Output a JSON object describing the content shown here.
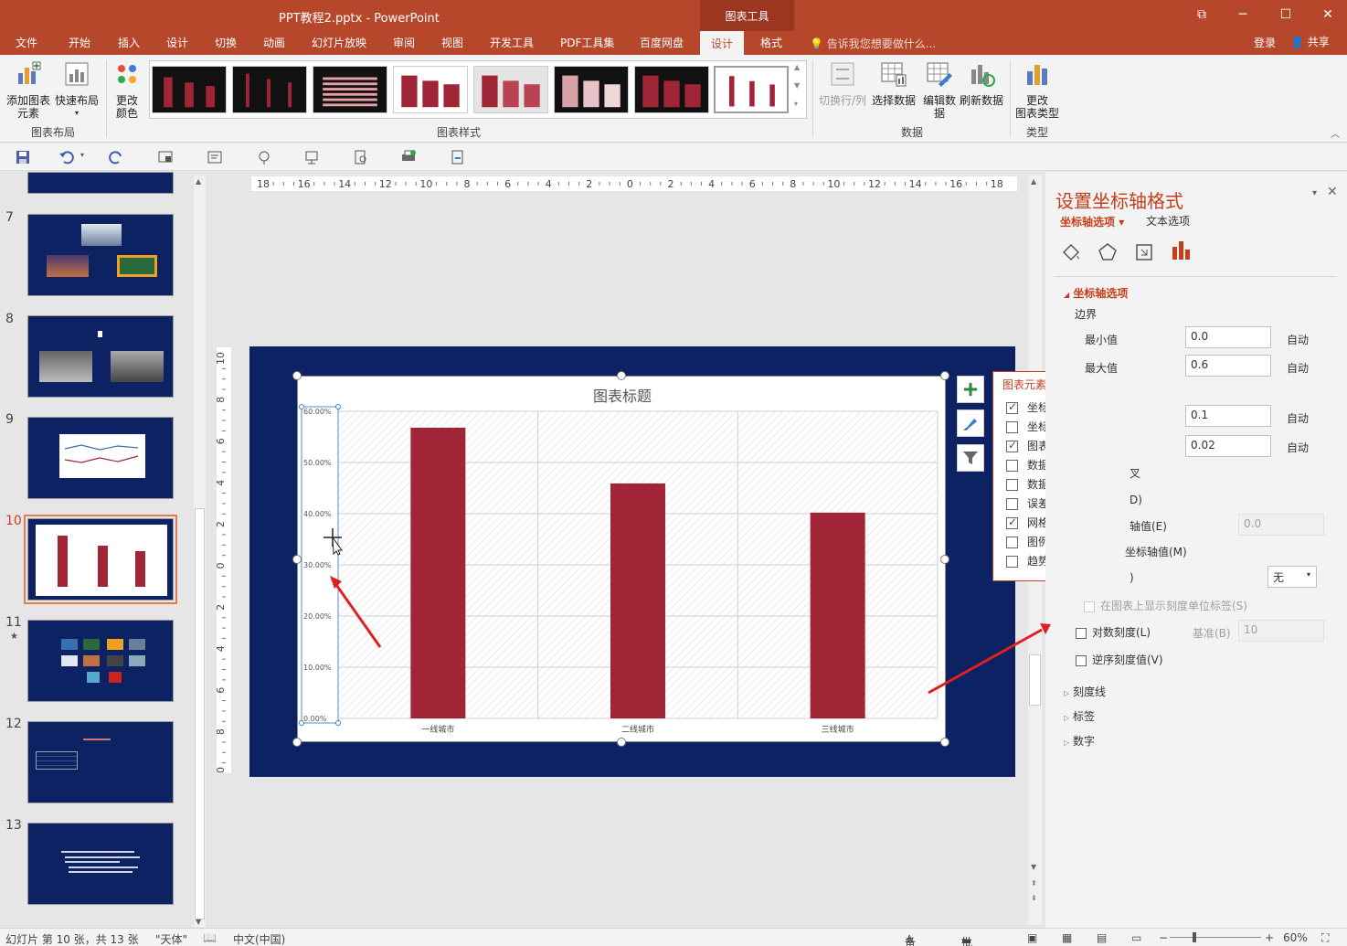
{
  "window": {
    "title": "PPT教程2.pptx - PowerPoint",
    "context_group": "图表工具",
    "restore_glyph": "⧉",
    "minimize_glyph": "─",
    "maximize_glyph": "☐",
    "close_glyph": "✕"
  },
  "tabs": [
    "文件",
    "开始",
    "插入",
    "设计",
    "切换",
    "动画",
    "幻灯片放映",
    "审阅",
    "视图",
    "开发工具",
    "PDF工具集",
    "百度网盘",
    "设计",
    "格式"
  ],
  "active_tab_index": 12,
  "tell_me": "告诉我您想要做什么...",
  "login": "登录",
  "share": "共享",
  "ribbon": {
    "add_element": "添加图表\n元素",
    "quick_layout": "快速布局",
    "group_layout": "图表布局",
    "change_colors": "更改\n颜色",
    "group_styles": "图表样式",
    "switch_row_col": "切换行/列",
    "select_data": "选择数据",
    "edit_data": "编辑数\n据",
    "refresh_data": "刷新数据",
    "group_data": "数据",
    "change_type": "更改\n图表类型",
    "group_type": "类型"
  },
  "slides": [
    {
      "num": "7"
    },
    {
      "num": "8"
    },
    {
      "num": "9"
    },
    {
      "num": "10"
    },
    {
      "num": "11",
      "star": "★"
    },
    {
      "num": "12"
    },
    {
      "num": "13"
    }
  ],
  "ruler": {
    "h_labels": [
      "18",
      "16",
      "14",
      "12",
      "10",
      "8",
      "6",
      "4",
      "2",
      "0",
      "2",
      "4",
      "6",
      "8",
      "10",
      "12",
      "14",
      "16",
      "18"
    ],
    "v_labels": [
      "10",
      "8",
      "6",
      "4",
      "2",
      "0",
      "2",
      "4",
      "6",
      "8",
      "10"
    ]
  },
  "chart_data": {
    "type": "bar",
    "title": "图表标题",
    "categories": [
      "一线城市",
      "二线城市",
      "三线城市"
    ],
    "values": [
      0.568,
      0.459,
      0.402
    ],
    "ylim": [
      0.0,
      0.6
    ],
    "ytick_labels": [
      "0.00%",
      "10.00%",
      "20.00%",
      "30.00%",
      "40.00%",
      "50.00%",
      "60.00%"
    ],
    "bar_color": "#a02637",
    "grid": true
  },
  "chart_elements": {
    "header": "图表元素",
    "items": [
      {
        "label": "坐标轴",
        "checked": true
      },
      {
        "label": "坐标轴标题",
        "checked": false
      },
      {
        "label": "图表标题",
        "checked": true
      },
      {
        "label": "数据标签",
        "checked": false
      },
      {
        "label": "数据表",
        "checked": false
      },
      {
        "label": "误差线",
        "checked": false
      },
      {
        "label": "网格线",
        "checked": true
      },
      {
        "label": "图例",
        "checked": false
      },
      {
        "label": "趋势线",
        "checked": false
      }
    ]
  },
  "format_pane": {
    "title": "设置坐标轴格式",
    "tab_axis": "坐标轴选项",
    "tab_text": "文本选项",
    "section_axis": "坐标轴选项",
    "bounds": "边界",
    "min_label": "最小值",
    "min_value": "0.0",
    "max_label": "最大值",
    "max_value": "0.6",
    "major_value": "0.1",
    "minor_value": "0.02",
    "auto": "自动",
    "cross_partial": "叉",
    "cross_auto_partial": "D)",
    "axis_value_partial": "轴值(E)",
    "axis_value": "0.0",
    "max_axis_partial": "坐标轴值(M)",
    "display_units_partial": ")",
    "display_units_value": "无",
    "show_units_label": "在图表上显示刻度单位标签(S)",
    "log_scale": "对数刻度(L)",
    "base_label": "基准(B)",
    "base_value": "10",
    "reverse_order": "逆序刻度值(V)",
    "tick_marks": "刻度线",
    "labels": "标签",
    "number": "数字"
  },
  "status": {
    "slide_info": "幻灯片 第 10 张，共 13 张",
    "theme": "\"天体\"",
    "language": "中文(中国)",
    "notes": "备注",
    "comments": "批注",
    "zoom": "60%"
  },
  "colors": {
    "accent": "#b7472a",
    "slide_bg": "#0d2263",
    "bar": "#a02637"
  }
}
